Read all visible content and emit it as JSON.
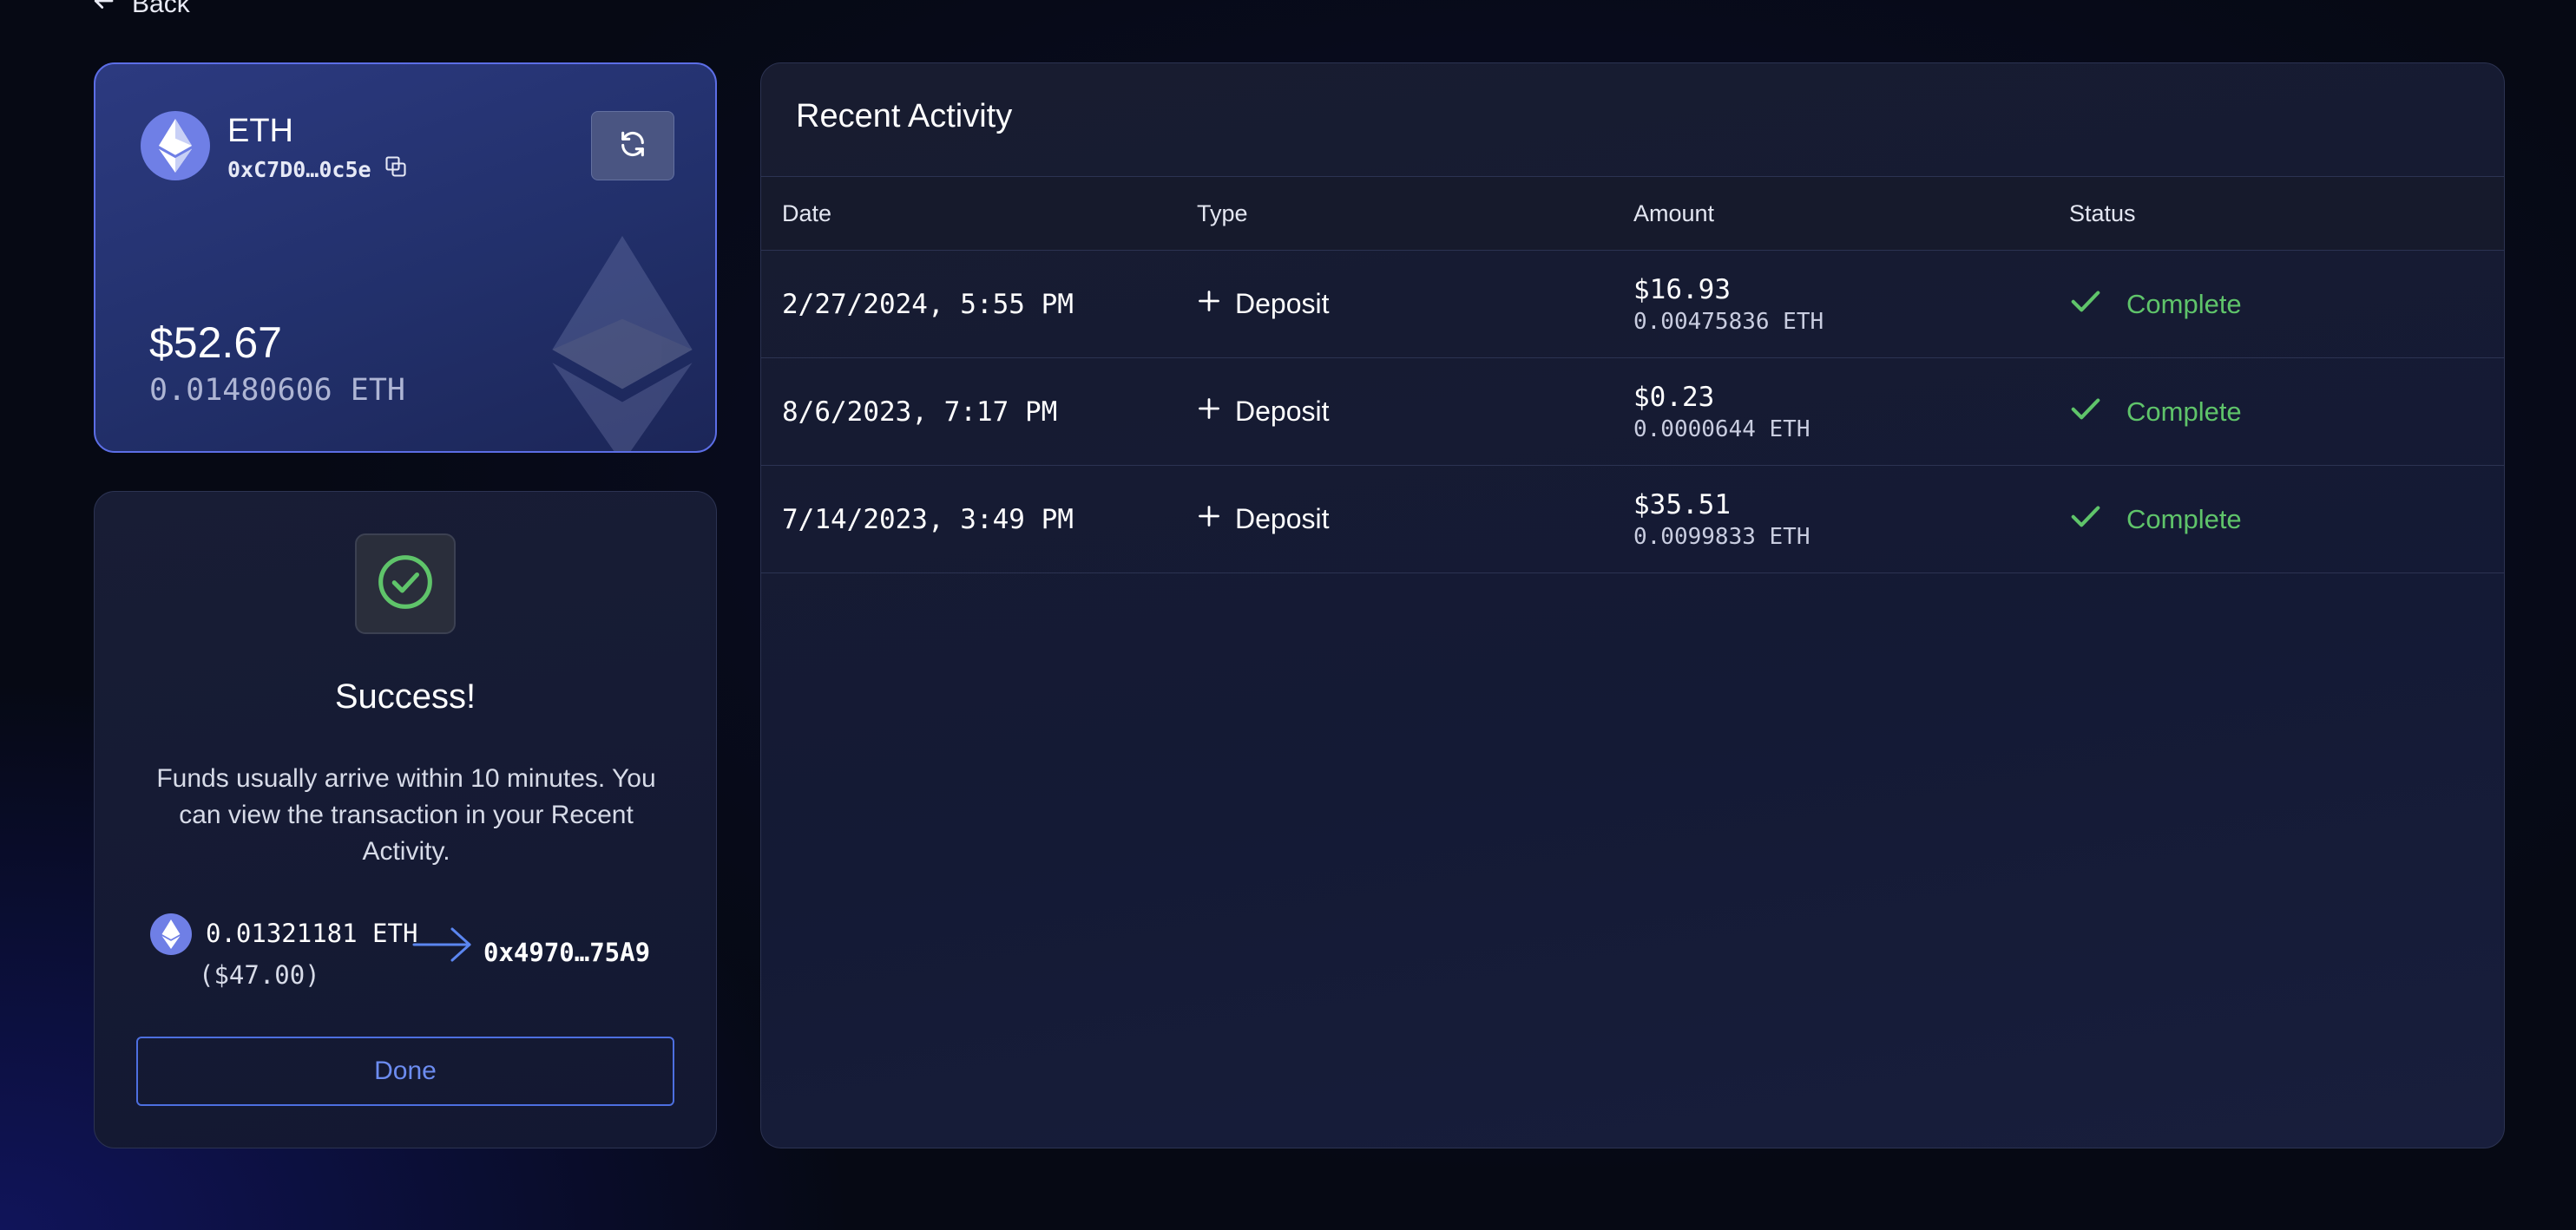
{
  "nav": {
    "back_label": "Back"
  },
  "wallet": {
    "asset": "ETH",
    "address": "0xC7D0…0c5e",
    "balance_usd": "$52.67",
    "balance_eth": "0.01480606 ETH"
  },
  "success": {
    "title": "Success!",
    "message": "Funds usually arrive within 10 minutes. You can view the transaction in your Recent Activity.",
    "amount_eth": "0.01321181 ETH",
    "amount_usd": "($47.00)",
    "destination": "0x4970…75A9",
    "done_label": "Done"
  },
  "activity": {
    "title": "Recent Activity",
    "columns": [
      "Date",
      "Type",
      "Amount",
      "Status"
    ],
    "rows": [
      {
        "date": "2/27/2024, 5:55 PM",
        "type": "Deposit",
        "amount_usd": "$16.93",
        "amount_eth": "0.00475836 ETH",
        "status": "Complete"
      },
      {
        "date": "8/6/2023, 7:17 PM",
        "type": "Deposit",
        "amount_usd": "$0.23",
        "amount_eth": "0.0000644 ETH",
        "status": "Complete"
      },
      {
        "date": "7/14/2023, 3:49 PM",
        "type": "Deposit",
        "amount_usd": "$35.51",
        "amount_eth": "0.0099833 ETH",
        "status": "Complete"
      }
    ]
  },
  "colors": {
    "accent": "#4d6fe0",
    "success": "#5fc46a",
    "eth_logo": "#6f7fe6",
    "card_border": "#5c6ee6"
  },
  "icons": [
    "arrow-left-icon",
    "ethereum-icon",
    "copy-icon",
    "refresh-icon",
    "check-circle-icon",
    "arrow-right-icon",
    "plus-icon",
    "check-icon"
  ]
}
